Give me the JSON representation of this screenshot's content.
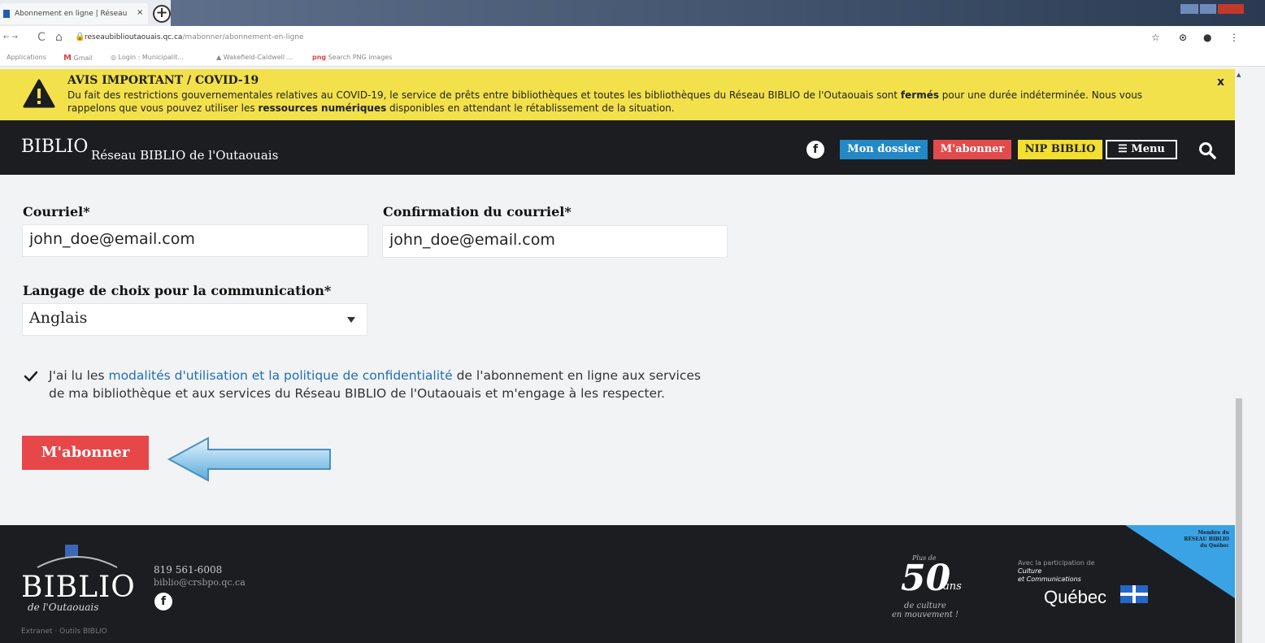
{
  "browser": {
    "tab_title": "Abonnement en ligne | Réseau",
    "tab_close": "×",
    "new_tab": "+",
    "url_host": "reseaubiblioutaouais.qc.ca",
    "url_path": "/mabonner/abonnement-en-ligne",
    "bookmarks": [
      "Applications",
      "Gmail",
      "Login : Municipalit...",
      "Wakefield-Caldwell ...",
      "Search PNG images"
    ]
  },
  "alert": {
    "title": "AVIS IMPORTANT / COVID-19",
    "body_1": "Du fait des restrictions gouvernementales relatives au COVID-19, le service de prêts entre bibliothèques et toutes les bibliothèques du Réseau BIBLIO de l'Outaouais sont ",
    "body_bold_1": "fermés",
    "body_2": " pour une durée indéterminée. Nous vous rappelons que vous pouvez utiliser les ",
    "body_bold_2": "ressources numériques",
    "body_3": " disponibles en attendant le rétablissement de la situation.",
    "close": "x"
  },
  "header": {
    "logo": "BIBLIO",
    "site_title": "Réseau BIBLIO de l'Outaouais",
    "facebook": "f",
    "btn_dossier": "Mon dossier",
    "btn_abonner": "M'abonner",
    "btn_nip": "NIP BIBLIO",
    "btn_menu": "☰ Menu"
  },
  "form": {
    "email_label": "Courriel*",
    "email_value": "john_doe@email.com",
    "email_confirm_label": "Confirmation du courriel*",
    "email_confirm_value": "john_doe@email.com",
    "language_label": "Langage de choix pour la communication*",
    "language_value": "Anglais",
    "terms_prefix": "J'ai lu les ",
    "terms_link": "modalités d'utilisation et la politique de confidentialité",
    "terms_suffix": " de l'abonnement en ligne aux services de ma bibliothèque et aux services du Réseau BIBLIO de l'Outaouais et m'engage à les respecter.",
    "terms_checked": true,
    "submit_label": "M'abonner"
  },
  "footer": {
    "logo": "BIBLIO",
    "logo_sub": "de l'Outaouais",
    "phone": "819 561-6008",
    "email": "biblio@crsbpo.qc.ca",
    "facebook": "f",
    "links": "Extranet · Outils BIBLIO",
    "fifty": "50",
    "fifty_ans": "ans",
    "fifty_top": "Plus de",
    "fifty_sub_1": "de culture",
    "fifty_sub_2": "en mouvement !",
    "qc_line1": "Avec la participation de",
    "qc_line2": "Culture",
    "qc_line3": "et Communications",
    "quebec": "Québec",
    "corner_1": "Membre du",
    "corner_2": "RÉSEAU BIBLIO",
    "corner_3": "du Québec"
  },
  "colors": {
    "alert_bg": "#f3e14b",
    "header_bg": "#1c1d21",
    "dossier": "#2389c6",
    "abonner": "#e24b4b",
    "nip": "#f2df30",
    "link": "#1f6fb5",
    "submit": "#e8474a"
  }
}
